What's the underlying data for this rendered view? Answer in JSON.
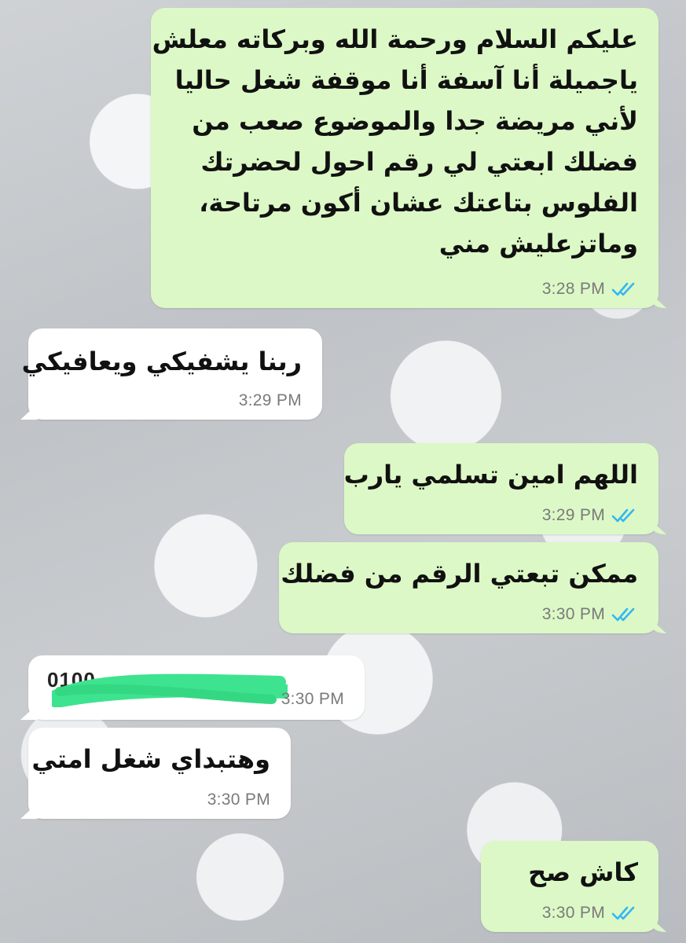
{
  "messages": [
    {
      "direction": "outgoing",
      "lines": [
        "عليكم السلام ورحمة الله وبركاته معلش",
        "ياجميلة أنا آسفة أنا موقفة شغل حاليا",
        "لأني مريضة جدا والموضوع صعب من",
        "فضلك ابعتي لي رقم احول لحضرتك",
        "الفلوس بتاعتك عشان أكون مرتاحة،",
        "وماتزعليش مني"
      ],
      "time": "3:28 PM",
      "status": "read"
    },
    {
      "direction": "incoming",
      "lines": [
        "ربنا يشفيكي ويعافيكي"
      ],
      "time": "3:29 PM"
    },
    {
      "direction": "outgoing",
      "lines": [
        "اللهم امين تسلمي يارب"
      ],
      "time": "3:29 PM",
      "status": "read"
    },
    {
      "direction": "outgoing",
      "lines": [
        "ممكن تبعتي الرقم من فضلك"
      ],
      "time": "3:30 PM",
      "status": "read"
    },
    {
      "direction": "incoming",
      "lines": [],
      "redacted_prefix": "0100",
      "time": "3:30 PM",
      "note": "phone number redacted by green scribble"
    },
    {
      "direction": "incoming",
      "lines": [
        "وهتبداي شغل امتي"
      ],
      "time": "3:30 PM"
    },
    {
      "direction": "outgoing",
      "lines": [
        "كاش صح"
      ],
      "time": "3:30 PM",
      "status": "read"
    }
  ],
  "icons": {
    "read_receipt": "double-check-icon"
  },
  "colors": {
    "outgoing_bubble": "#dcf8c6",
    "incoming_bubble": "#ffffff",
    "read_tick": "#34b7f1",
    "redaction": "#3ee38f",
    "timestamp": "#7a7a7a"
  }
}
